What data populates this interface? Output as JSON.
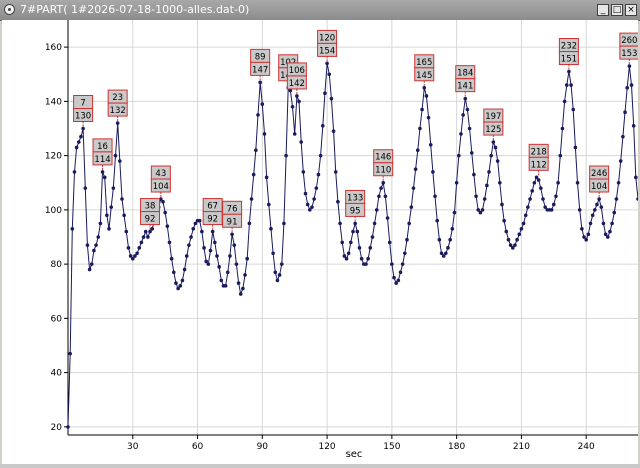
{
  "window": {
    "title": "7#PART(  1#2026-07-18-1000-alles.dat-0)",
    "minimize_glyph": "_",
    "maximize_glyph": "□",
    "close_glyph": "×"
  },
  "chart_data": {
    "type": "line",
    "xlabel": "sec",
    "ylabel": "",
    "title": "",
    "xlim": [
      0,
      264
    ],
    "ylim": [
      17,
      170
    ],
    "x_ticks": [
      30,
      60,
      90,
      120,
      150,
      180,
      210,
      240
    ],
    "y_ticks": [
      20,
      40,
      60,
      80,
      100,
      120,
      140,
      160
    ],
    "grid": true,
    "line_color": "#1a1a5e",
    "label_box_color": "#c9c9c9",
    "label_border_color": "#d03030",
    "series": [
      {
        "values": [
          [
            0,
            20
          ],
          [
            1,
            47
          ],
          [
            2,
            93
          ],
          [
            3,
            114
          ],
          [
            4,
            123
          ],
          [
            5,
            125
          ],
          [
            6,
            127
          ],
          [
            7,
            130
          ],
          [
            8,
            108
          ],
          [
            9,
            87
          ],
          [
            10,
            78
          ],
          [
            11,
            80
          ],
          [
            12,
            85
          ],
          [
            13,
            87
          ],
          [
            14,
            90
          ],
          [
            15,
            95
          ],
          [
            16,
            114
          ],
          [
            17,
            112
          ],
          [
            18,
            98
          ],
          [
            19,
            93
          ],
          [
            20,
            101
          ],
          [
            21,
            108
          ],
          [
            22,
            120
          ],
          [
            23,
            132
          ],
          [
            24,
            118
          ],
          [
            25,
            104
          ],
          [
            26,
            98
          ],
          [
            27,
            92
          ],
          [
            28,
            86
          ],
          [
            29,
            83
          ],
          [
            30,
            82
          ],
          [
            31,
            83
          ],
          [
            32,
            84
          ],
          [
            33,
            86
          ],
          [
            34,
            88
          ],
          [
            35,
            90
          ],
          [
            36,
            92
          ],
          [
            37,
            90
          ],
          [
            38,
            92
          ],
          [
            39,
            93
          ],
          [
            40,
            96
          ],
          [
            41,
            98
          ],
          [
            42,
            101
          ],
          [
            43,
            104
          ],
          [
            44,
            103
          ],
          [
            45,
            99
          ],
          [
            46,
            94
          ],
          [
            47,
            88
          ],
          [
            48,
            82
          ],
          [
            49,
            77
          ],
          [
            50,
            73
          ],
          [
            51,
            71
          ],
          [
            52,
            72
          ],
          [
            53,
            74
          ],
          [
            54,
            78
          ],
          [
            55,
            83
          ],
          [
            56,
            87
          ],
          [
            57,
            90
          ],
          [
            58,
            93
          ],
          [
            59,
            95
          ],
          [
            60,
            96
          ],
          [
            61,
            96
          ],
          [
            62,
            92
          ],
          [
            63,
            86
          ],
          [
            64,
            81
          ],
          [
            65,
            80
          ],
          [
            66,
            85
          ],
          [
            67,
            92
          ],
          [
            68,
            88
          ],
          [
            69,
            83
          ],
          [
            70,
            79
          ],
          [
            71,
            74
          ],
          [
            72,
            72
          ],
          [
            73,
            72
          ],
          [
            74,
            77
          ],
          [
            75,
            83
          ],
          [
            76,
            91
          ],
          [
            77,
            87
          ],
          [
            78,
            80
          ],
          [
            79,
            73
          ],
          [
            80,
            69
          ],
          [
            81,
            71
          ],
          [
            82,
            76
          ],
          [
            83,
            82
          ],
          [
            84,
            95
          ],
          [
            85,
            104
          ],
          [
            86,
            113
          ],
          [
            87,
            122
          ],
          [
            88,
            135
          ],
          [
            89,
            147
          ],
          [
            90,
            139
          ],
          [
            91,
            128
          ],
          [
            92,
            112
          ],
          [
            93,
            102
          ],
          [
            94,
            93
          ],
          [
            95,
            84
          ],
          [
            96,
            77
          ],
          [
            97,
            74
          ],
          [
            98,
            76
          ],
          [
            99,
            80
          ],
          [
            100,
            95
          ],
          [
            101,
            120
          ],
          [
            102,
            145
          ],
          [
            103,
            144
          ],
          [
            104,
            138
          ],
          [
            105,
            128
          ],
          [
            106,
            142
          ],
          [
            107,
            140
          ],
          [
            108,
            125
          ],
          [
            109,
            114
          ],
          [
            110,
            106
          ],
          [
            111,
            102
          ],
          [
            112,
            100
          ],
          [
            113,
            101
          ],
          [
            114,
            104
          ],
          [
            115,
            108
          ],
          [
            116,
            113
          ],
          [
            117,
            120
          ],
          [
            118,
            131
          ],
          [
            119,
            143
          ],
          [
            120,
            154
          ],
          [
            121,
            150
          ],
          [
            122,
            141
          ],
          [
            123,
            129
          ],
          [
            124,
            114
          ],
          [
            125,
            103
          ],
          [
            126,
            95
          ],
          [
            127,
            88
          ],
          [
            128,
            83
          ],
          [
            129,
            82
          ],
          [
            130,
            84
          ],
          [
            131,
            88
          ],
          [
            132,
            92
          ],
          [
            133,
            95
          ],
          [
            134,
            92
          ],
          [
            135,
            86
          ],
          [
            136,
            82
          ],
          [
            137,
            80
          ],
          [
            138,
            80
          ],
          [
            139,
            82
          ],
          [
            140,
            86
          ],
          [
            141,
            90
          ],
          [
            142,
            95
          ],
          [
            143,
            100
          ],
          [
            144,
            105
          ],
          [
            145,
            108
          ],
          [
            146,
            110
          ],
          [
            147,
            105
          ],
          [
            148,
            97
          ],
          [
            149,
            88
          ],
          [
            150,
            80
          ],
          [
            151,
            75
          ],
          [
            152,
            73
          ],
          [
            153,
            74
          ],
          [
            154,
            77
          ],
          [
            155,
            80
          ],
          [
            156,
            84
          ],
          [
            157,
            89
          ],
          [
            158,
            95
          ],
          [
            159,
            101
          ],
          [
            160,
            108
          ],
          [
            161,
            115
          ],
          [
            162,
            122
          ],
          [
            163,
            130
          ],
          [
            164,
            137
          ],
          [
            165,
            145
          ],
          [
            166,
            142
          ],
          [
            167,
            134
          ],
          [
            168,
            124
          ],
          [
            169,
            114
          ],
          [
            170,
            105
          ],
          [
            171,
            96
          ],
          [
            172,
            89
          ],
          [
            173,
            84
          ],
          [
            174,
            83
          ],
          [
            175,
            84
          ],
          [
            176,
            86
          ],
          [
            177,
            89
          ],
          [
            178,
            93
          ],
          [
            179,
            99
          ],
          [
            180,
            110
          ],
          [
            181,
            120
          ],
          [
            182,
            128
          ],
          [
            183,
            135
          ],
          [
            184,
            141
          ],
          [
            185,
            137
          ],
          [
            186,
            130
          ],
          [
            187,
            121
          ],
          [
            188,
            113
          ],
          [
            189,
            105
          ],
          [
            190,
            100
          ],
          [
            191,
            99
          ],
          [
            192,
            100
          ],
          [
            193,
            104
          ],
          [
            194,
            109
          ],
          [
            195,
            114
          ],
          [
            196,
            120
          ],
          [
            197,
            125
          ],
          [
            198,
            123
          ],
          [
            199,
            118
          ],
          [
            200,
            110
          ],
          [
            201,
            102
          ],
          [
            202,
            96
          ],
          [
            203,
            92
          ],
          [
            204,
            89
          ],
          [
            205,
            87
          ],
          [
            206,
            86
          ],
          [
            207,
            87
          ],
          [
            208,
            89
          ],
          [
            209,
            91
          ],
          [
            210,
            93
          ],
          [
            211,
            95
          ],
          [
            212,
            98
          ],
          [
            213,
            101
          ],
          [
            214,
            104
          ],
          [
            215,
            107
          ],
          [
            216,
            110
          ],
          [
            217,
            112
          ],
          [
            218,
            111
          ],
          [
            219,
            108
          ],
          [
            220,
            104
          ],
          [
            221,
            101
          ],
          [
            222,
            100
          ],
          [
            223,
            100
          ],
          [
            224,
            100
          ],
          [
            225,
            102
          ],
          [
            226,
            105
          ],
          [
            227,
            110
          ],
          [
            228,
            120
          ],
          [
            229,
            130
          ],
          [
            230,
            140
          ],
          [
            231,
            146
          ],
          [
            232,
            151
          ],
          [
            233,
            146
          ],
          [
            234,
            137
          ],
          [
            235,
            123
          ],
          [
            236,
            110
          ],
          [
            237,
            100
          ],
          [
            238,
            93
          ],
          [
            239,
            90
          ],
          [
            240,
            89
          ],
          [
            241,
            91
          ],
          [
            242,
            95
          ],
          [
            243,
            98
          ],
          [
            244,
            100
          ],
          [
            245,
            102
          ],
          [
            246,
            104
          ],
          [
            247,
            101
          ],
          [
            248,
            95
          ],
          [
            249,
            91
          ],
          [
            250,
            90
          ],
          [
            251,
            92
          ],
          [
            252,
            95
          ],
          [
            253,
            99
          ],
          [
            254,
            104
          ],
          [
            255,
            110
          ],
          [
            256,
            118
          ],
          [
            257,
            127
          ],
          [
            258,
            136
          ],
          [
            259,
            145
          ],
          [
            260,
            153
          ],
          [
            261,
            146
          ],
          [
            262,
            131
          ],
          [
            263,
            112
          ],
          [
            264,
            104
          ]
        ]
      }
    ],
    "annotations": [
      {
        "x": 7,
        "y": 130,
        "top": "7",
        "bottom": "130"
      },
      {
        "x": 16,
        "y": 114,
        "top": "16",
        "bottom": "114"
      },
      {
        "x": 23,
        "y": 132,
        "top": "23",
        "bottom": "132"
      },
      {
        "x": 38,
        "y": 92,
        "top": "38",
        "bottom": "92"
      },
      {
        "x": 43,
        "y": 104,
        "top": "43",
        "bottom": "104"
      },
      {
        "x": 67,
        "y": 92,
        "top": "67",
        "bottom": "92"
      },
      {
        "x": 76,
        "y": 91,
        "top": "76",
        "bottom": "91"
      },
      {
        "x": 89,
        "y": 147,
        "top": "89",
        "bottom": "147"
      },
      {
        "x": 102,
        "y": 145,
        "top": "102",
        "bottom": "145"
      },
      {
        "x": 106,
        "y": 142,
        "top": "106",
        "bottom": "142"
      },
      {
        "x": 120,
        "y": 154,
        "top": "120",
        "bottom": "154"
      },
      {
        "x": 133,
        "y": 95,
        "top": "133",
        "bottom": "95"
      },
      {
        "x": 146,
        "y": 110,
        "top": "146",
        "bottom": "110"
      },
      {
        "x": 165,
        "y": 145,
        "top": "165",
        "bottom": "145"
      },
      {
        "x": 184,
        "y": 141,
        "top": "184",
        "bottom": "141"
      },
      {
        "x": 197,
        "y": 125,
        "top": "197",
        "bottom": "125"
      },
      {
        "x": 218,
        "y": 112,
        "top": "218",
        "bottom": "112"
      },
      {
        "x": 232,
        "y": 151,
        "top": "232",
        "bottom": "151"
      },
      {
        "x": 246,
        "y": 104,
        "top": "246",
        "bottom": "104"
      },
      {
        "x": 260,
        "y": 153,
        "top": "260",
        "bottom": "153"
      }
    ]
  }
}
